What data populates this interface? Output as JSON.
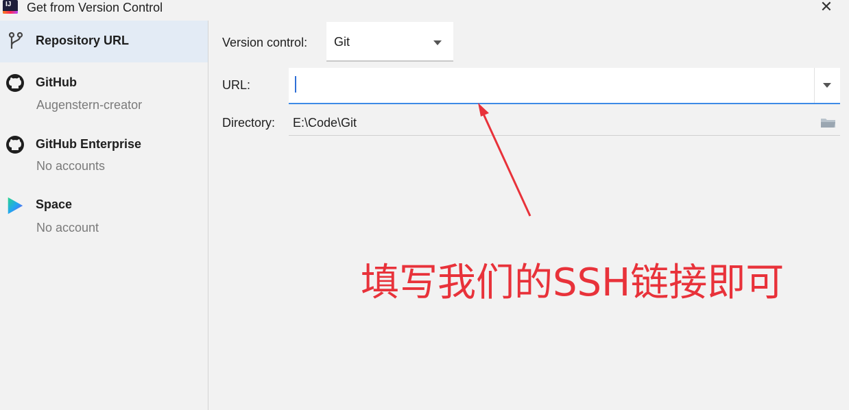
{
  "window": {
    "title": "Get from Version Control",
    "close_glyph": "✕"
  },
  "sidebar": {
    "items": [
      {
        "label": "Repository URL",
        "sub": "",
        "icon": "branch-icon",
        "selected": true
      },
      {
        "label": "GitHub",
        "sub": "Augenstern-creator",
        "icon": "github-icon",
        "selected": false
      },
      {
        "label": "GitHub Enterprise",
        "sub": "No accounts",
        "icon": "github-icon",
        "selected": false
      },
      {
        "label": "Space",
        "sub": "No account",
        "icon": "space-icon",
        "selected": false
      }
    ]
  },
  "form": {
    "version_control_label": "Version control:",
    "version_control_value": "Git",
    "url_label": "URL:",
    "url_value": "",
    "directory_label": "Directory:",
    "directory_value": "E:\\Code\\Git"
  },
  "annotation": {
    "text": "填写我们的SSH链接即可",
    "color": "#e8323a"
  },
  "colors": {
    "accent": "#3d8ae6",
    "selected_bg": "#e3ebf5",
    "annotation": "#e8323a"
  }
}
